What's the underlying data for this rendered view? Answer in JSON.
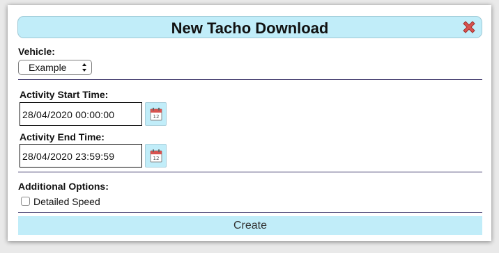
{
  "dialog": {
    "title": "New Tacho Download",
    "close_icon": "close-x-icon"
  },
  "vehicle": {
    "label": "Vehicle:",
    "selected": "Example"
  },
  "activity_start": {
    "label": "Activity Start Time:",
    "value": "28/04/2020 00:00:00",
    "icon": "calendar-icon"
  },
  "activity_end": {
    "label": "Activity End Time:",
    "value": "28/04/2020 23:59:59",
    "icon": "calendar-icon"
  },
  "options": {
    "label": "Additional Options:",
    "detailed_speed_label": "Detailed Speed",
    "detailed_speed_checked": false
  },
  "create_button": {
    "label": "Create"
  },
  "colors": {
    "accent": "#c1edf9",
    "close": "#d9534f",
    "divider": "#3a3468"
  }
}
